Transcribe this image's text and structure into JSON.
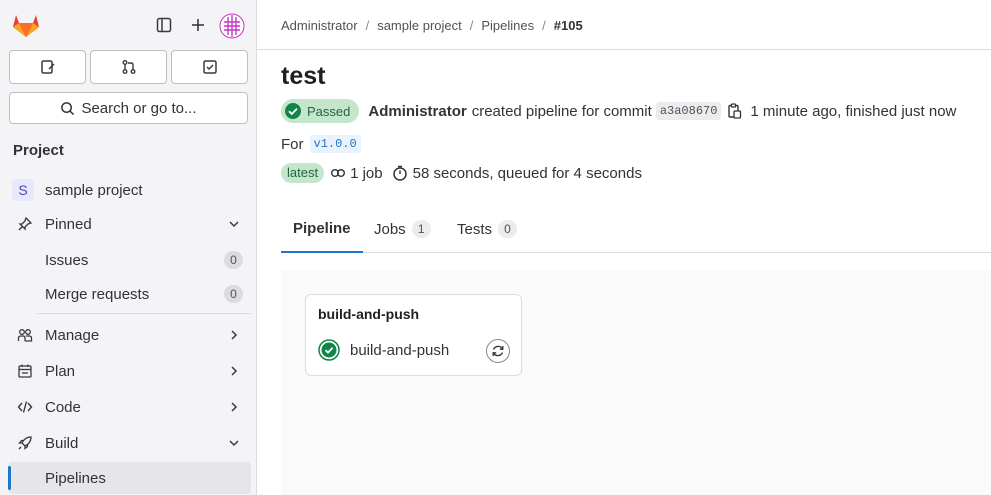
{
  "sidebar": {
    "search_label": "Search or go to...",
    "section_title": "Project",
    "project_name": "sample project",
    "project_initial": "S",
    "items": [
      {
        "label": "Pinned"
      },
      {
        "label": "Issues",
        "count": "0"
      },
      {
        "label": "Merge requests",
        "count": "0"
      },
      {
        "label": "Manage"
      },
      {
        "label": "Plan"
      },
      {
        "label": "Code"
      },
      {
        "label": "Build"
      },
      {
        "label": "Pipelines"
      }
    ]
  },
  "breadcrumb": {
    "items": [
      "Administrator",
      "sample project",
      "Pipelines",
      "#105"
    ],
    "separator": "/"
  },
  "pipeline": {
    "title": "test",
    "status": "Passed",
    "author": "Administrator",
    "action_text": "created pipeline for commit",
    "commit_sha": "a3a08670",
    "time_text": "1 minute ago, finished just now",
    "for_label": "For",
    "ref": "v1.0.0",
    "latest_badge": "latest",
    "jobs_text": "1 job",
    "duration_text": "58 seconds, queued for 4 seconds"
  },
  "tabs": [
    {
      "label": "Pipeline"
    },
    {
      "label": "Jobs",
      "count": "1"
    },
    {
      "label": "Tests",
      "count": "0"
    }
  ],
  "graph": {
    "stage_name": "build-and-push",
    "job_name": "build-and-push"
  },
  "colors": {
    "accent": "#1f75cb",
    "success": "#108548",
    "success_bg": "#c3e6cd"
  }
}
